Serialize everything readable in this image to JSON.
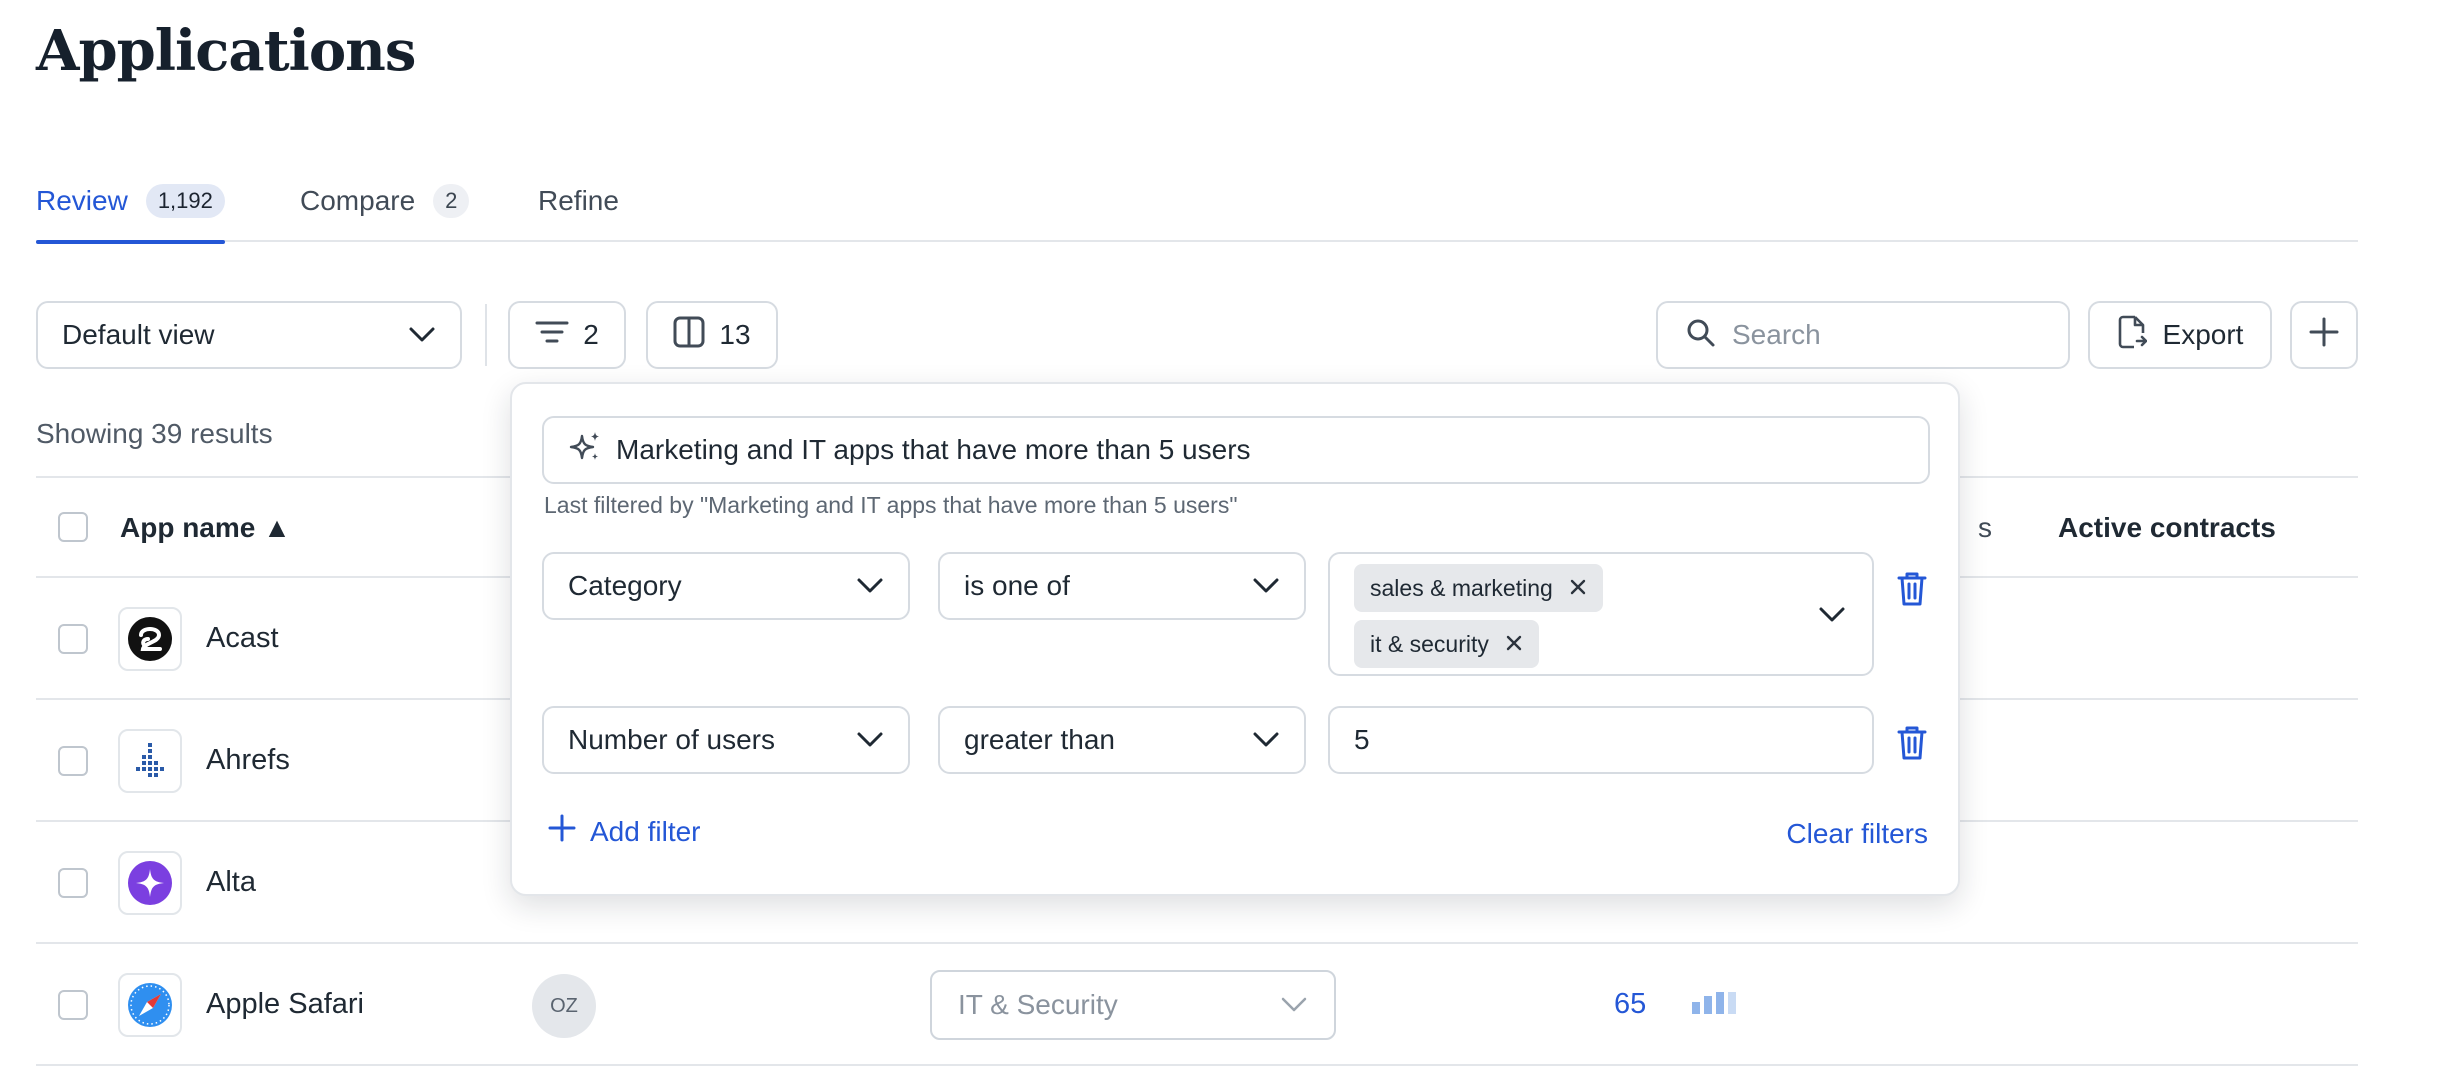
{
  "page": {
    "title": "Applications"
  },
  "tabs": [
    {
      "label": "Review",
      "badge": "1,192",
      "active": true
    },
    {
      "label": "Compare",
      "badge": "2",
      "active": false
    },
    {
      "label": "Refine",
      "badge": "",
      "active": false
    }
  ],
  "toolbar": {
    "view_label": "Default view",
    "filter_count": "2",
    "columns_count": "13",
    "search_placeholder": "Search",
    "export_label": "Export"
  },
  "results_text": "Showing 39 results",
  "table": {
    "columns": {
      "app_name": "App name ▲",
      "partial": "s",
      "active_contracts": "Active contracts"
    },
    "rows": [
      {
        "name": "Acast",
        "owner": "",
        "category": "",
        "users": ""
      },
      {
        "name": "Ahrefs",
        "owner": "",
        "category": "",
        "users": ""
      },
      {
        "name": "Alta",
        "owner": "",
        "category": "",
        "users": ""
      },
      {
        "name": "Apple Safari",
        "owner": "OZ",
        "category": "IT & Security",
        "users": "65"
      }
    ]
  },
  "filter_popover": {
    "ai_query": "Marketing and IT apps that have more than 5 users",
    "last_filtered": "Last filtered by \"Marketing and IT apps that have more than 5 users\"",
    "filters": [
      {
        "field": "Category",
        "operator": "is one of",
        "values": [
          "sales & marketing",
          "it & security"
        ]
      },
      {
        "field": "Number of users",
        "operator": "greater than",
        "value": "5"
      }
    ],
    "add_filter_label": "Add filter",
    "clear_filters_label": "Clear filters"
  },
  "colors": {
    "accent": "#2457d6",
    "border": "#d6dbe1",
    "chip_bg": "#e6e8eb",
    "usage_bars": "#8fb4ea"
  }
}
